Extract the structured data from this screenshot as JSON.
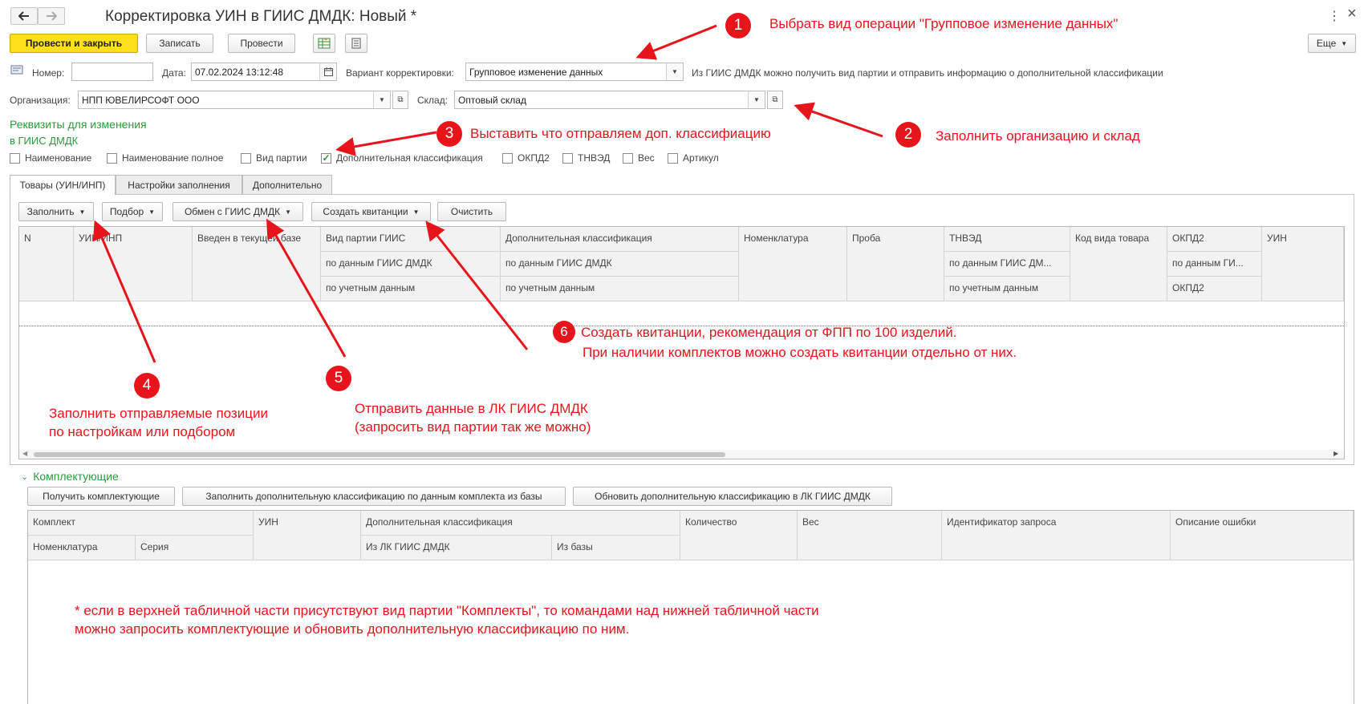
{
  "window": {
    "title": "Корректировка УИН в ГИИС ДМДК: Новый *",
    "more_icon": "⋮",
    "close_icon": "×"
  },
  "toolbar": {
    "post_close": "Провести и закрыть",
    "save": "Записать",
    "post": "Провести",
    "more": "Еще"
  },
  "header": {
    "number_label": "Номер:",
    "number_value": "",
    "date_label": "Дата:",
    "date_value": "07.02.2024 13:12:48",
    "variant_label": "Вариант корректировки:",
    "variant_value": "Групповое изменение данных",
    "variant_hint": "Из ГИИС ДМДК можно получить вид партии и отправить информацию о дополнительной классификации",
    "org_label": "Организация:",
    "org_value": "НПП ЮВЕЛИРСОФТ ООО",
    "warehouse_label": "Склад:",
    "warehouse_value": "Оптовый склад"
  },
  "requisites": {
    "title_line1": "Реквизиты для изменения",
    "title_line2": "в ГИИС ДМДК",
    "checkboxes": [
      {
        "label": "Наименование",
        "checked": false
      },
      {
        "label": "Наименование полное",
        "checked": false
      },
      {
        "label": "Вид партии",
        "checked": false
      },
      {
        "label": "Дополнительная классификация",
        "checked": true
      },
      {
        "label": "ОКПД2",
        "checked": false
      },
      {
        "label": "ТНВЭД",
        "checked": false
      },
      {
        "label": "Вес",
        "checked": false
      },
      {
        "label": "Артикул",
        "checked": false
      }
    ]
  },
  "tabs": [
    "Товары (УИН/ИНП)",
    "Настройки заполнения",
    "Дополнительно"
  ],
  "goods_toolbar": {
    "fill": "Заполнить",
    "pick": "Подбор",
    "exchange": "Обмен с ГИИС ДМДК",
    "receipts": "Создать квитанции",
    "clear": "Очистить"
  },
  "goods_table": {
    "col_n": "N",
    "col_uin": "УИН/ИНП",
    "col_in_db": "Введен в текущей базе",
    "col_batch": "Вид партии ГИИС",
    "col_addclass": "Дополнительная классификация",
    "col_nomen": "Номенклатура",
    "col_proba": "Проба",
    "col_tnved": "ТНВЭД",
    "col_code": "Код вида товара",
    "col_okpd": "ОКПД2",
    "col_uin2": "УИН",
    "by_giis": "по данным ГИИС ДМДК",
    "by_account": "по учетным данным",
    "tnved_giis": "по данным ГИИС ДМ...",
    "okpd_giis": "по данным ГИ...",
    "okpd_sub": "ОКПД2"
  },
  "components": {
    "title": "Комплектующие",
    "get_btn": "Получить комплектующие",
    "fill_btn": "Заполнить дополнительную классификацию по данным комплекта из базы",
    "update_btn": "Обновить дополнительную классификацию в ЛК ГИИС ДМДК",
    "col_kit": "Комплект",
    "col_nomen": "Номенклатура",
    "col_series": "Серия",
    "col_uin": "УИН",
    "col_addclass": "Дополнительная классификация",
    "col_from_lk": "Из ЛК ГИИС ДМДК",
    "col_from_db": "Из базы",
    "col_qty": "Количество",
    "col_weight": "Вес",
    "col_request": "Идентификатор запроса",
    "col_error": "Описание ошибки"
  },
  "annotations": {
    "n1": "1",
    "t1": "Выбрать вид операции \"Групповое изменение данных\"",
    "n2": "2",
    "t2": "Заполнить организацию и склад",
    "n3": "3",
    "t3": "Выставить что отправляем доп. классифиацию",
    "n4": "4",
    "t4a": "Заполнить отправляемые позиции",
    "t4b": "по настройкам или подбором",
    "n5": "5",
    "t5a": "Отправить данные в ЛК ГИИС ДМДК",
    "t5b": "(запросить вид партии так же можно)",
    "n6": "6",
    "t6a": "Создать квитанции, рекомендация от ФПП по 100 изделий.",
    "t6b": "При наличии комплектов можно создать квитанции отдельно от них.",
    "note1": "* если в верхней табличной части присутствуют вид партии \"Комплекты\", то командами над нижней табличной части",
    "note2": "можно запросить комплектующие и обновить дополнительную классификацию по ним."
  },
  "colors": {
    "accent_yellow": "#ffe01a",
    "green": "#2a9a3a",
    "annotation_red": "#e8141b"
  }
}
